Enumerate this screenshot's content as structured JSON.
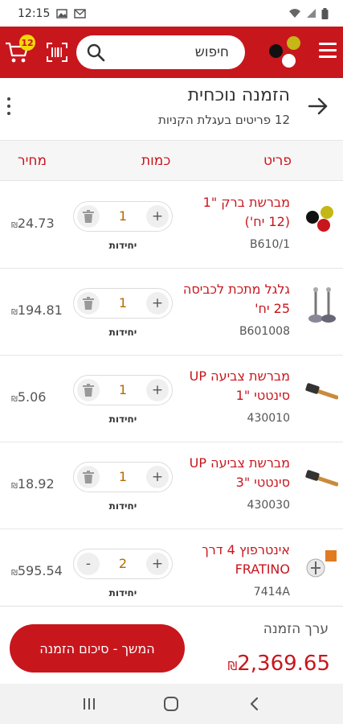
{
  "status_bar": {
    "time": "12:15"
  },
  "app_bar": {
    "search_placeholder": "חיפוש",
    "cart_count": "12"
  },
  "order": {
    "title": "הזמנה נוכחית",
    "subtitle": "12 פריטים בעגלת הקניות"
  },
  "columns": {
    "item": "פריט",
    "quantity": "כמות",
    "price": "מחיר"
  },
  "items": [
    {
      "name": "מברשת ברק \"1 (12 יח')",
      "sku": "B610/1",
      "quantity": "1",
      "unit": "יחידות",
      "price": "24.73",
      "image": "brush-logo-icon",
      "left_action": "trash"
    },
    {
      "name": "גלגל מתכת לכביסה 25 יח'",
      "sku": "B601008",
      "quantity": "1",
      "unit": "יחידות",
      "price": "194.81",
      "image": "metal-wheel-icon",
      "left_action": "trash"
    },
    {
      "name": "מברשת צביעה UP סינטטי \"1",
      "sku": "430010",
      "quantity": "1",
      "unit": "יחידות",
      "price": "5.06",
      "image": "paint-brush-icon",
      "left_action": "trash"
    },
    {
      "name": "מברשת צביעה UP סינטטי \"3",
      "sku": "430030",
      "quantity": "1",
      "unit": "יחידות",
      "price": "18.92",
      "image": "paint-brush-icon",
      "left_action": "trash"
    },
    {
      "name": "אינטרפוץ 4 דרך FRATINO",
      "sku": "7414A",
      "quantity": "2",
      "unit": "יחידות",
      "price": "595.54",
      "image": "faucet-icon",
      "left_action": "minus"
    }
  ],
  "currency_symbol": "₪",
  "footer": {
    "order_value_label": "ערך הזמנה",
    "total": "2,369.65",
    "checkout_label": "המשך - סיכום הזמנה"
  },
  "colors": {
    "brand_red": "#c8161d",
    "badge_yellow": "#f2d70a",
    "quantity_orange": "#b36c00"
  }
}
